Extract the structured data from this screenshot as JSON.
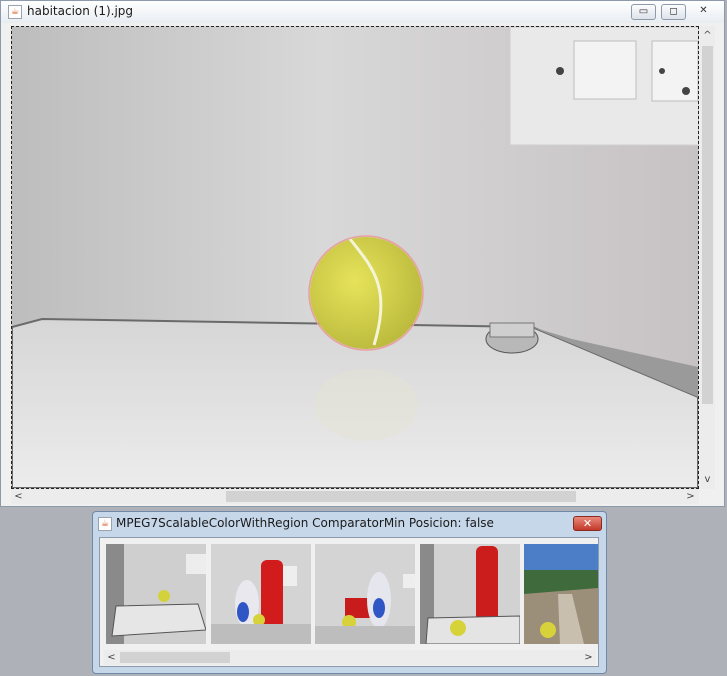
{
  "main_window": {
    "title": "habitacion (1).jpg",
    "minimize_glyph": "▭",
    "maximize_glyph": "◻",
    "close_glyph": "✕",
    "scroll_left": "<",
    "scroll_right": ">",
    "scroll_up": "^",
    "scroll_down": "v"
  },
  "results_window": {
    "title": "MPEG7ScalableColorWithRegion ComparatorMin Posicion: false",
    "close_glyph": "✕",
    "thumbnails": [
      {
        "name": "result-thumbnail-1"
      },
      {
        "name": "result-thumbnail-2"
      },
      {
        "name": "result-thumbnail-3"
      },
      {
        "name": "result-thumbnail-4"
      },
      {
        "name": "result-thumbnail-5"
      }
    ]
  },
  "colors": {
    "title_active": "#c6d7ea",
    "close_red": "#c3392a",
    "region_outline": "#e8a0a0",
    "ball_yellow": "#d8d84a"
  }
}
